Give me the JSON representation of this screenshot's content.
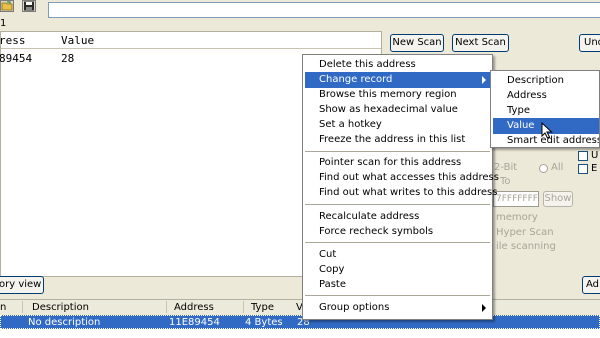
{
  "toolbar": {
    "open_icon": "folder-open-icon",
    "save_icon": "floppy-disk-icon",
    "process_path": ""
  },
  "found": {
    "count": "1",
    "columns": {
      "address": "ress",
      "value": "Value"
    },
    "row": {
      "address": "89454",
      "value": "28"
    }
  },
  "scan": {
    "new_scan": "New Scan",
    "next_scan": "Next Scan",
    "undo_scan": "Und"
  },
  "options": {
    "bit_label": "2-Bit",
    "all_label": "All",
    "to_label": "To",
    "hex_value": "7FFFFFFF",
    "show_button": "Show",
    "memory_label": "memory",
    "hyper_scan_label": "Hyper Scan",
    "while_scanning_label": "ile scanning",
    "checkbox_u": "U",
    "checkbox_e": "E"
  },
  "memory_view_button": "ory view",
  "add_button": "Ad",
  "address_list": {
    "columns": {
      "active": "n",
      "description": "Description",
      "address": "Address",
      "type": "Type",
      "value": "Value"
    },
    "rows": [
      {
        "description": "No description",
        "address": "11E89454",
        "type": "4 Bytes",
        "value": "28"
      }
    ]
  },
  "context_menu": {
    "group1": [
      "Delete this address",
      "Change record",
      "Browse this memory region",
      "Show as hexadecimal value",
      "Set a hotkey",
      "Freeze the address in this list"
    ],
    "group2": [
      "Pointer scan for this address",
      "Find out what accesses this address",
      "Find out what writes to this address"
    ],
    "group3": [
      "Recalculate address",
      "Force recheck symbols"
    ],
    "group4": [
      "Cut",
      "Copy",
      "Paste"
    ],
    "group5": [
      "Group options"
    ]
  },
  "submenu": {
    "items": [
      "Description",
      "Address",
      "Type",
      "Value",
      "Smart edit address(es)"
    ]
  },
  "colors": {
    "selection": "#316ac5",
    "window_bg": "#ece9d8",
    "button_border": "#003c74"
  }
}
